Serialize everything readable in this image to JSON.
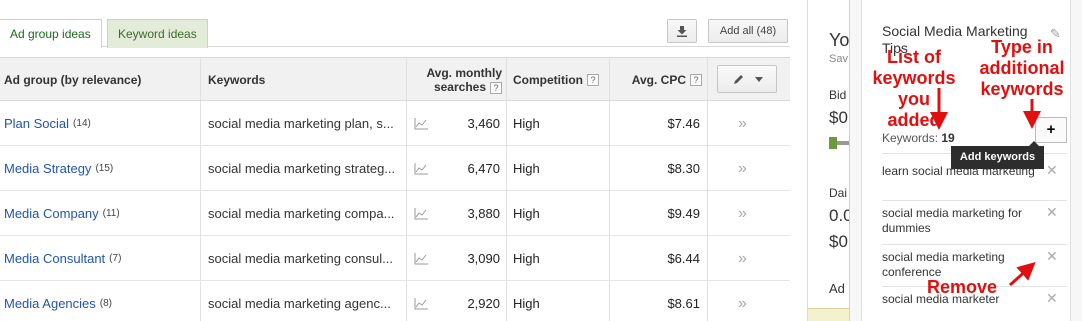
{
  "tabs": {
    "ad_group_ideas": "Ad group ideas",
    "keyword_ideas": "Keyword ideas"
  },
  "toolbar": {
    "download_icon": "download-icon",
    "add_all": "Add all (48)"
  },
  "table": {
    "headers": {
      "ad_group": "Ad group (by relevance)",
      "keywords": "Keywords",
      "avg_monthly_line1": "Avg. monthly",
      "avg_monthly_line2": "searches",
      "competition": "Competition",
      "avg_cpc": "Avg. CPC",
      "help": "?"
    },
    "rows": [
      {
        "group": "Plan Social",
        "count": "(14)",
        "keywords": "social media marketing plan, s...",
        "searches": "3,460",
        "competition": "High",
        "cpc": "$7.46"
      },
      {
        "group": "Media Strategy",
        "count": "(15)",
        "keywords": "social media marketing strateg...",
        "searches": "6,470",
        "competition": "High",
        "cpc": "$8.30"
      },
      {
        "group": "Media Company",
        "count": "(11)",
        "keywords": "social media marketing compa...",
        "searches": "3,880",
        "competition": "High",
        "cpc": "$9.49"
      },
      {
        "group": "Media Consultant",
        "count": "(7)",
        "keywords": "social media marketing consul...",
        "searches": "3,090",
        "competition": "High",
        "cpc": "$6.44"
      },
      {
        "group": "Media Agencies",
        "count": "(8)",
        "keywords": "social media marketing agenc...",
        "searches": "2,920",
        "competition": "High",
        "cpc": "$8.61"
      }
    ]
  },
  "middle": {
    "yo": "Yo",
    "sav": "Sav",
    "bid": "Bid",
    "dollar0": "$0",
    "dai": "Dai",
    "zero": "0.0",
    "dollar0b": "$0",
    "ad": "Ad"
  },
  "plan": {
    "title": "Social Media Marketing Tips",
    "keywords_label": "Keywords:",
    "keywords_count": "19",
    "add_symbol": "+",
    "add_tooltip": "Add keywords",
    "items": [
      {
        "text": "learn social media marketing"
      },
      {
        "text": "social media marketing for dummies"
      },
      {
        "text": "social media marketing conference"
      },
      {
        "text": "social media marketer"
      }
    ],
    "remove_symbol": "✕"
  },
  "annotations": {
    "list_of": "List of",
    "keywords_you": "keywords you",
    "added": "added",
    "type_in": "Type in",
    "additional": "additional",
    "keywords": "keywords",
    "remove": "Remove"
  },
  "colors": {
    "annotation": "#e01010",
    "link": "#2255aa",
    "tab_active": "#1c6b1c"
  }
}
